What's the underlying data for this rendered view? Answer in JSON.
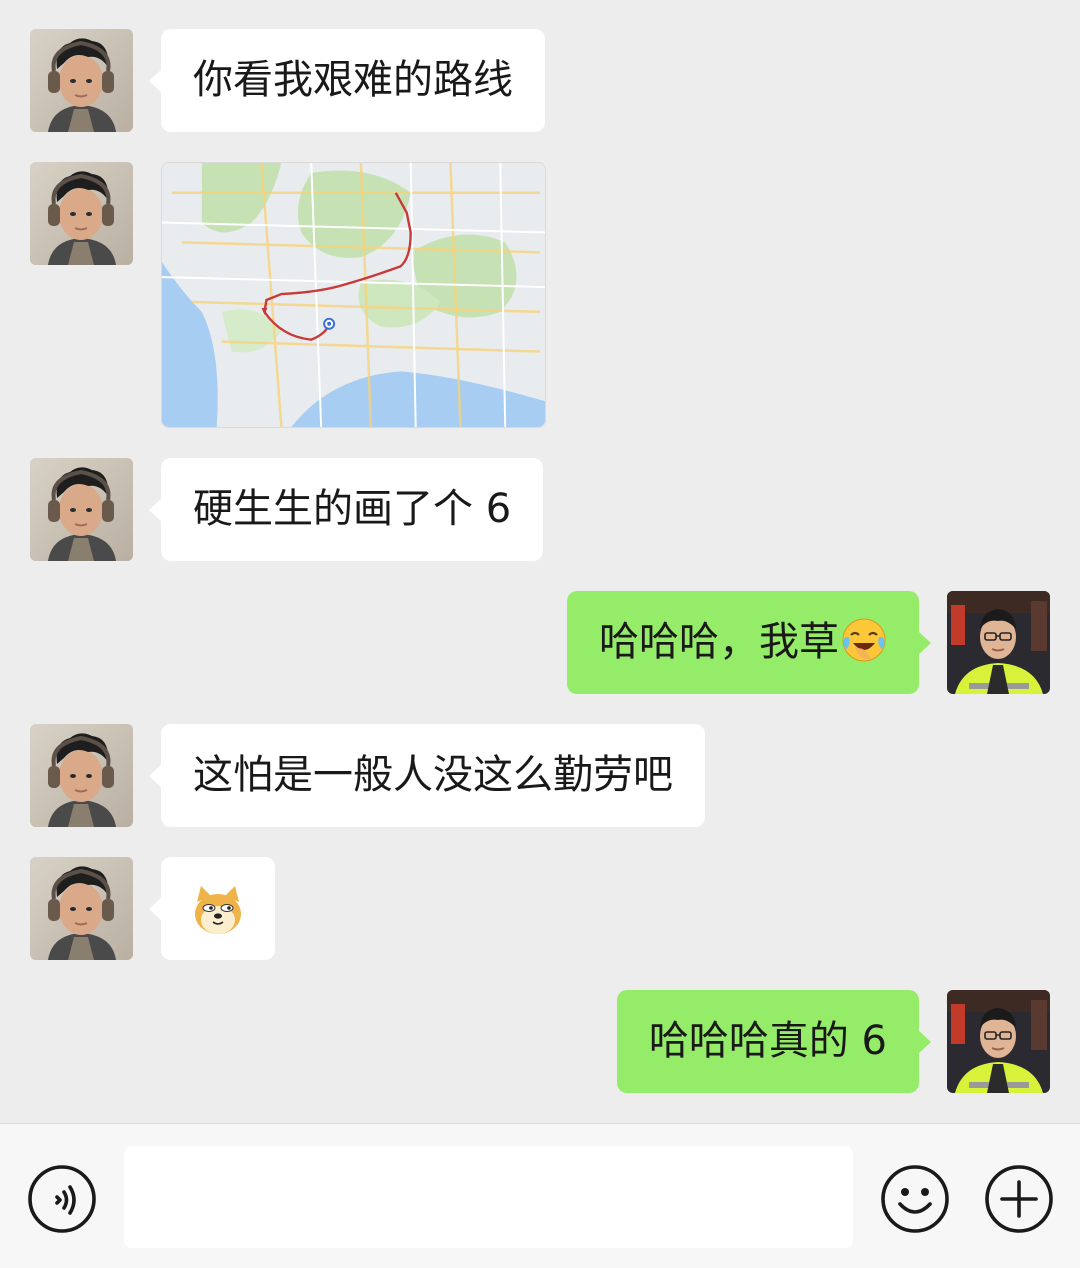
{
  "chat": {
    "messages": [
      {
        "type": "text",
        "side": "incoming",
        "text": "你看我艰难的路线"
      },
      {
        "type": "image",
        "side": "incoming",
        "description_icon": "map-route-image"
      },
      {
        "type": "text",
        "side": "incoming",
        "text": "硬生生的画了个 6"
      },
      {
        "type": "text",
        "side": "outgoing",
        "text": "哈哈哈，我草",
        "emoji": "face-with-tears-of-joy-icon"
      },
      {
        "type": "text",
        "side": "incoming",
        "text": "这怕是一般人没这么勤劳吧"
      },
      {
        "type": "sticker",
        "side": "incoming",
        "sticker": "doge-sticker-icon"
      },
      {
        "type": "text",
        "side": "outgoing",
        "text": "哈哈哈真的 6"
      }
    ]
  },
  "input_bar": {
    "input_value": "",
    "left_icon": "voice-icon",
    "right_icons": [
      "emoji-icon",
      "plus-icon"
    ]
  },
  "colors": {
    "background": "#ededed",
    "incoming_bubble": "#ffffff",
    "outgoing_bubble": "#95ec69",
    "input_bar": "#f7f7f7"
  }
}
